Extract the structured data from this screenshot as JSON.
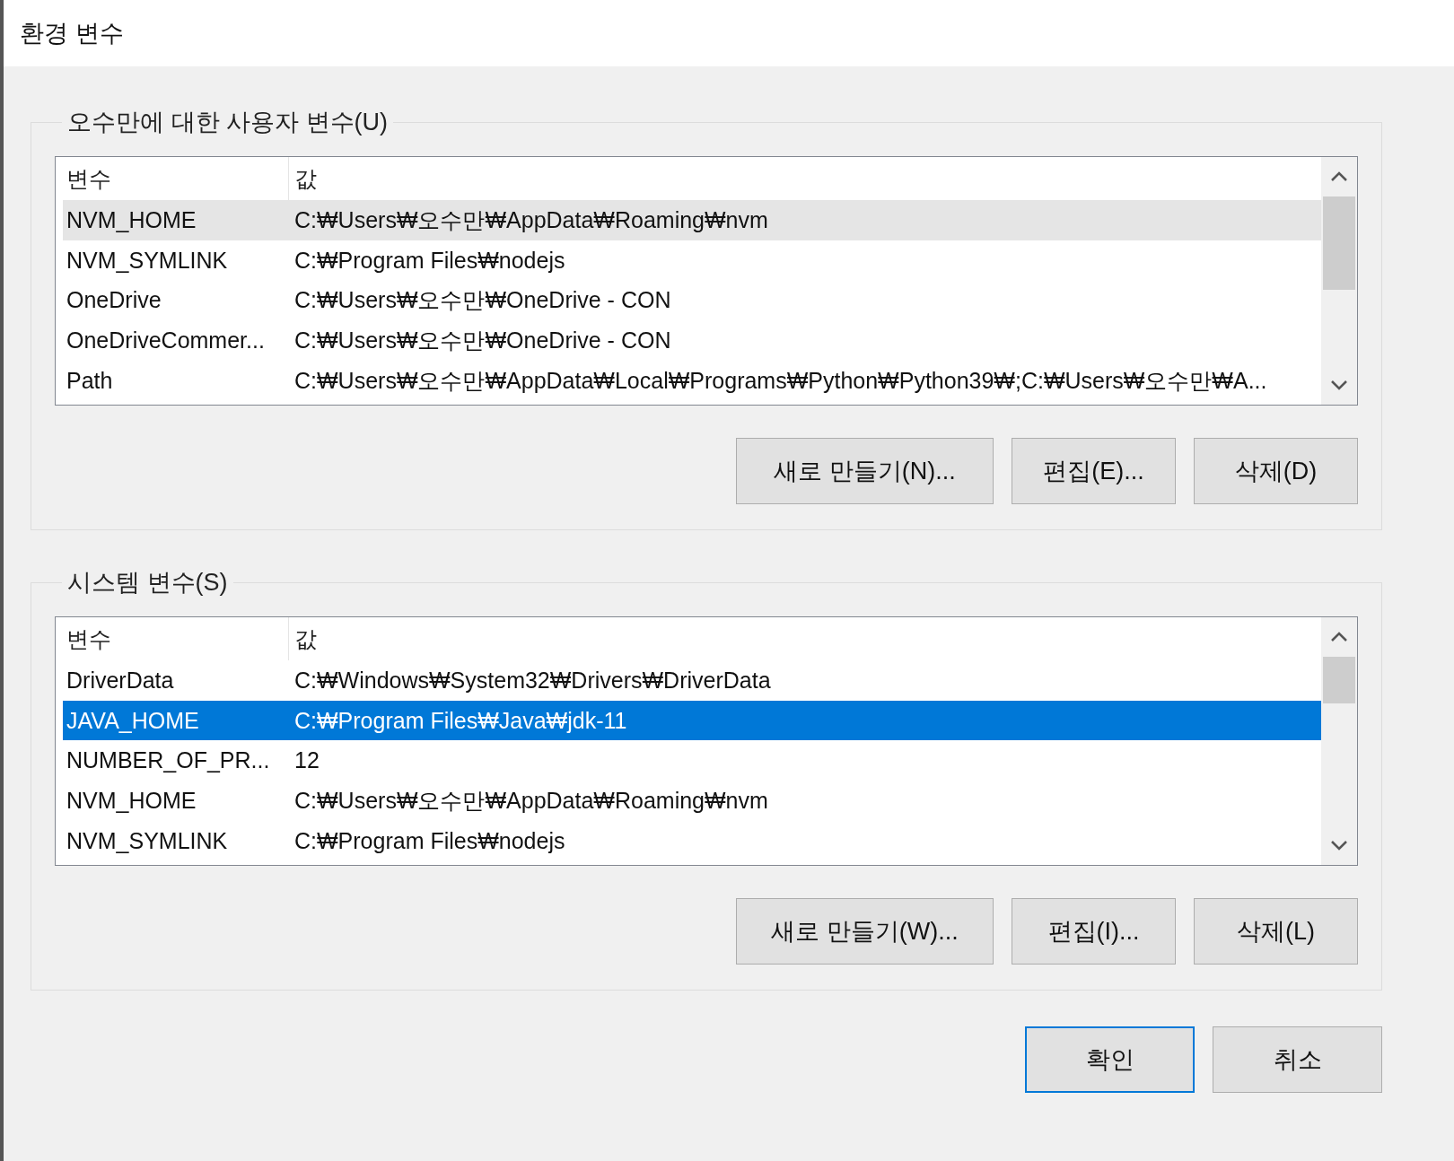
{
  "window": {
    "title": "환경 변수"
  },
  "groups": [
    {
      "label": "오수만에 대한 사용자 변수(U)",
      "columns": [
        "변수",
        "값"
      ],
      "rows": [
        {
          "name": "NVM_HOME",
          "value": "C:₩Users₩오수만₩AppData₩Roaming₩nvm",
          "selected": false,
          "hovered": true
        },
        {
          "name": "NVM_SYMLINK",
          "value": "C:₩Program Files₩nodejs",
          "selected": false,
          "hovered": false
        },
        {
          "name": "OneDrive",
          "value": "C:₩Users₩오수만₩OneDrive - CON",
          "selected": false,
          "hovered": false
        },
        {
          "name": "OneDriveCommer...",
          "value": "C:₩Users₩오수만₩OneDrive - CON",
          "selected": false,
          "hovered": false
        },
        {
          "name": "Path",
          "value": "C:₩Users₩오수만₩AppData₩Local₩Programs₩Python₩Python39₩;C:₩Users₩오수만₩A...",
          "selected": false,
          "hovered": false
        }
      ],
      "buttons": [
        "새로 만들기(N)...",
        "편집(E)...",
        "삭제(D)"
      ]
    },
    {
      "label": "시스템 변수(S)",
      "columns": [
        "변수",
        "값"
      ],
      "rows": [
        {
          "name": "DriverData",
          "value": "C:₩Windows₩System32₩Drivers₩DriverData",
          "selected": false,
          "hovered": false
        },
        {
          "name": "JAVA_HOME",
          "value": "C:₩Program Files₩Java₩jdk-11",
          "selected": true,
          "hovered": false
        },
        {
          "name": "NUMBER_OF_PR...",
          "value": "12",
          "selected": false,
          "hovered": false
        },
        {
          "name": "NVM_HOME",
          "value": "C:₩Users₩오수만₩AppData₩Roaming₩nvm",
          "selected": false,
          "hovered": false
        },
        {
          "name": "NVM_SYMLINK",
          "value": "C:₩Program Files₩nodejs",
          "selected": false,
          "hovered": false
        }
      ],
      "buttons": [
        "새로 만들기(W)...",
        "편집(I)...",
        "삭제(L)"
      ]
    }
  ],
  "buttons": [
    {
      "label": "확인",
      "default": true
    },
    {
      "label": "취소",
      "default": false
    }
  ]
}
